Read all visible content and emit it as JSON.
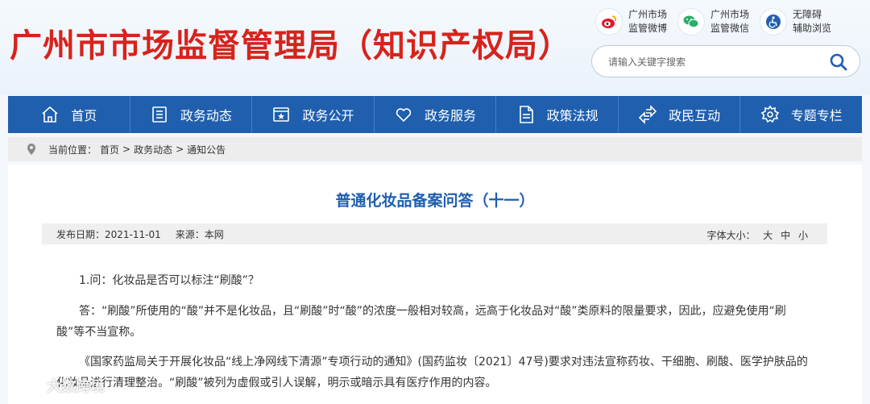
{
  "header": {
    "site_title": "广州市市场监督管理局（知识产权局）",
    "quick_links": [
      {
        "icon": "weibo-icon",
        "line1": "广州市场",
        "line2": "监管微博",
        "color": "#e6162d"
      },
      {
        "icon": "wechat-icon",
        "line1": "广州市场",
        "line2": "监管微信",
        "color": "#2aae67"
      },
      {
        "icon": "accessibility-icon",
        "line1": "无障碍",
        "line2": "辅助浏览",
        "color": "#1f5fae"
      }
    ],
    "search": {
      "placeholder": "请输入关键字搜索"
    }
  },
  "nav": {
    "items": [
      {
        "label": "首页",
        "icon": "home-icon"
      },
      {
        "label": "政务动态",
        "icon": "news-icon"
      },
      {
        "label": "政务公开",
        "icon": "public-icon"
      },
      {
        "label": "政务服务",
        "icon": "heart-icon"
      },
      {
        "label": "政策法规",
        "icon": "document-icon"
      },
      {
        "label": "政民互动",
        "icon": "interaction-icon"
      },
      {
        "label": "专题专栏",
        "icon": "gear-icon"
      }
    ]
  },
  "breadcrumb": {
    "prefix": "当前位置：",
    "items": [
      "首页",
      "政务动态",
      "通知公告"
    ],
    "separator": ">"
  },
  "article": {
    "title": "普通化妆品备案问答（十一）",
    "publish_date_label": "发布日期：",
    "publish_date": "2021-11-01",
    "source_label": "来源：",
    "source": "本网",
    "font_size_label": "字体大小：",
    "font_sizes": [
      "大",
      "中",
      "小"
    ],
    "paragraphs": [
      "1.问：化妆品是否可以标注“刷酸”？",
      "答：“刷酸”所使用的“酸”并不是化妆品，且“刷酸”时“酸”的浓度一般相对较高，远高于化妆品对“酸”类原料的限量要求，因此，应避免使用“刷酸”等不当宣称。",
      "《国家药监局关于开展化妆品“线上净网线下清源”专项行动的通知》(国药监妆〔2021〕47号)要求对违法宣称药妆、干细胞、刷酸、医学护肤品的化妆品进行清理整治。“刷酸”被列为虚假或引人误解，明示或暗示具有医疗作用的内容。"
    ]
  },
  "watermark": {
    "text": "大数跨境"
  },
  "colors": {
    "brand_red": "#d6231c",
    "nav_blue": "#1f5fae",
    "title_blue": "#1f5fae"
  }
}
